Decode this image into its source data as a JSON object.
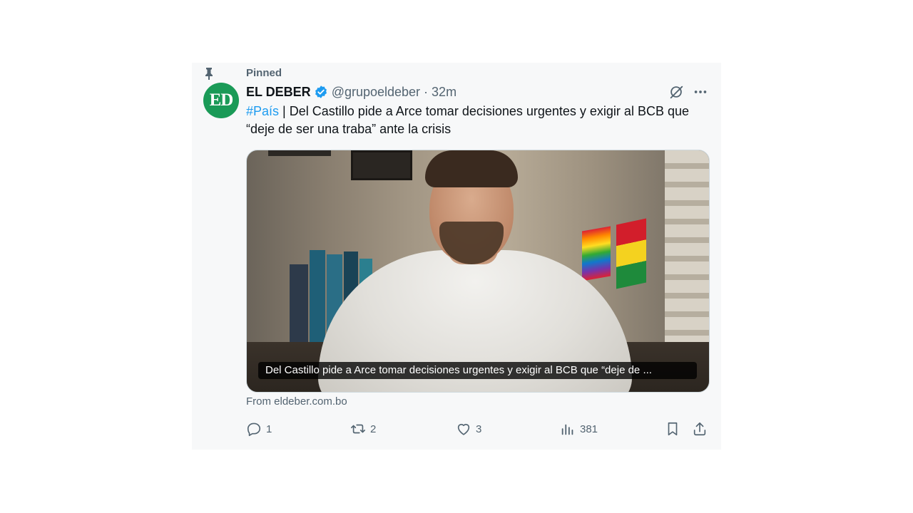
{
  "pinned": {
    "label": "Pinned"
  },
  "author": {
    "avatar_text": "ED",
    "name": "EL DEBER",
    "handle": "@grupoeldeber",
    "separator": "·",
    "time": "32m"
  },
  "tweet": {
    "hashtag": "#País",
    "text": " | Del Castillo pide a Arce tomar decisiones urgentes y exigir al BCB que “deje de ser una traba” ante la crisis"
  },
  "media": {
    "caption": "Del Castillo pide a Arce tomar decisiones urgentes y exigir al BCB que “deje de ..."
  },
  "source": {
    "text": "From eldeber.com.bo"
  },
  "actions": {
    "replies": "1",
    "reposts": "2",
    "likes": "3",
    "views": "381"
  },
  "colors": {
    "accent": "#1d9bf0",
    "avatar_bg": "#1a9a57",
    "muted": "#536471"
  }
}
